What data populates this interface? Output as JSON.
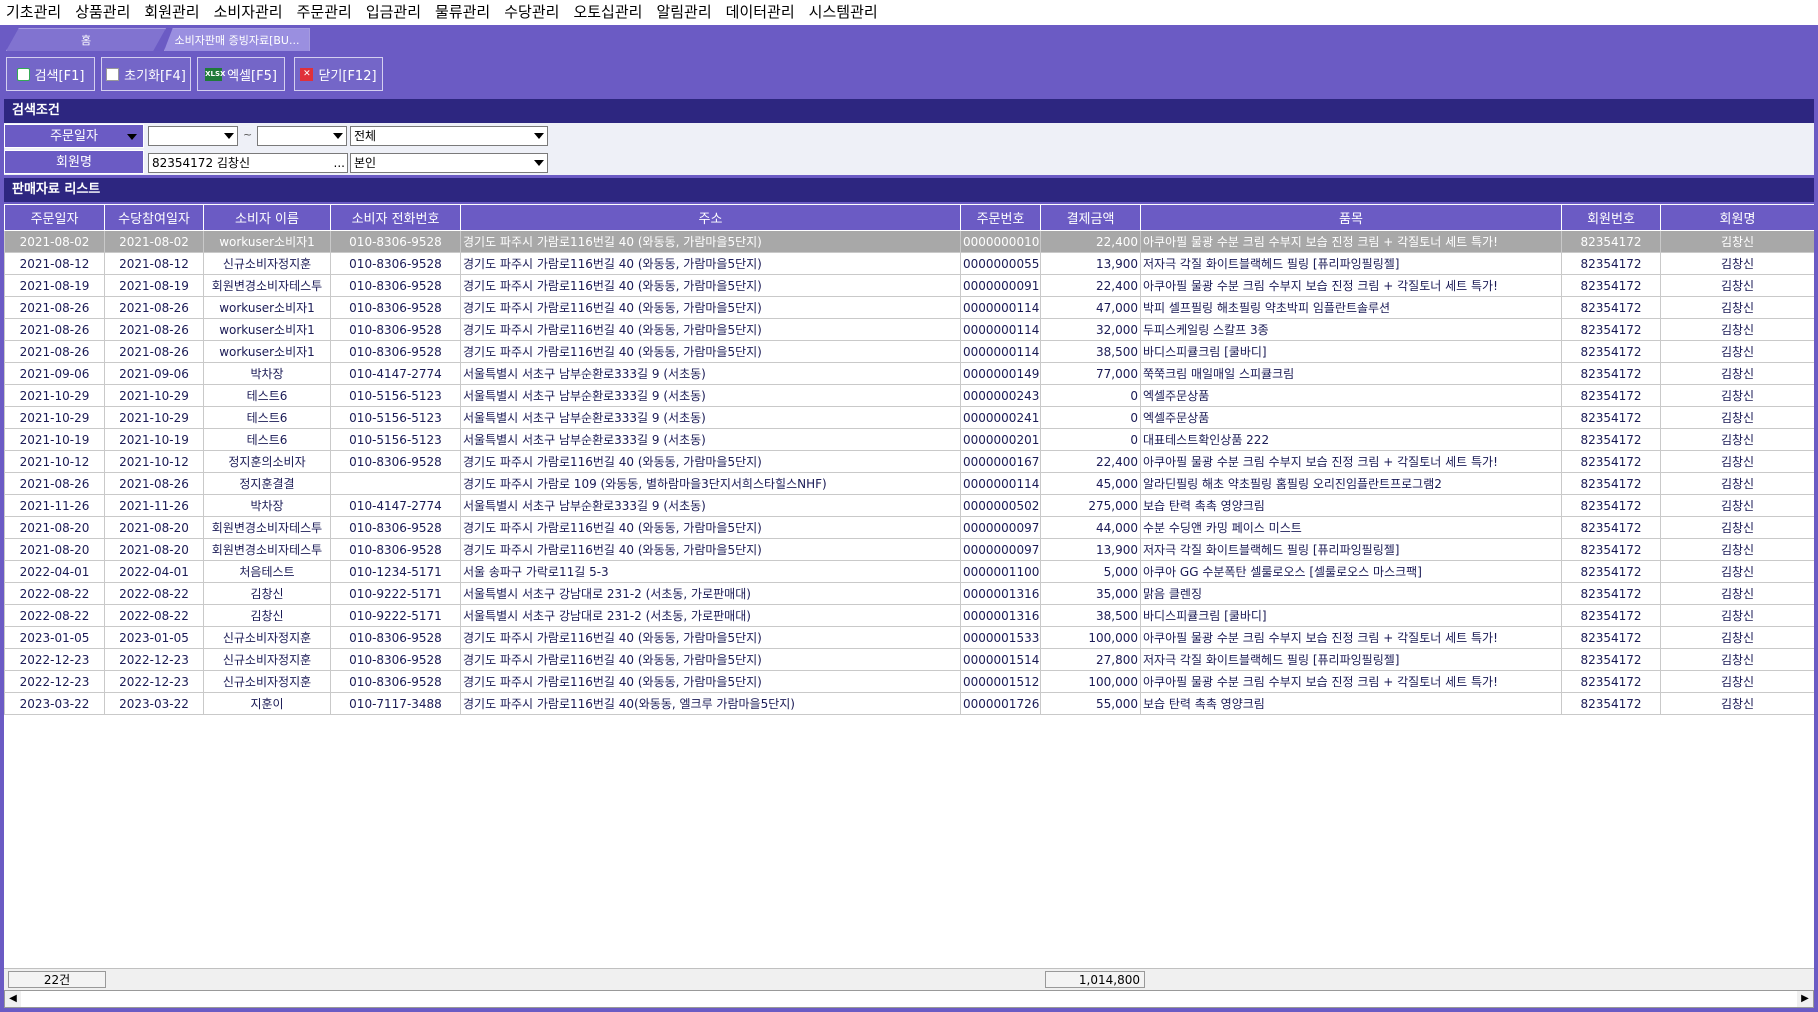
{
  "menu": [
    "기초관리",
    "상품관리",
    "회원관리",
    "소비자관리",
    "주문관리",
    "입금관리",
    "물류관리",
    "수당관리",
    "오토십관리",
    "알림관리",
    "데이터관리",
    "시스템관리"
  ],
  "tabs": {
    "home": "홈",
    "active": "소비자판매 증빙자료[BU..."
  },
  "toolbar": {
    "search": "검색[F1]",
    "reset": "초기화[F4]",
    "excel": "엑셀[F5]",
    "close": "닫기[F12]",
    "excel_icon_text": "XLSX"
  },
  "search_section": {
    "title": "검색조건",
    "order_date_label": "주문일자",
    "date_from": "",
    "tilde": "~",
    "date_to": "",
    "scope_value": "전체",
    "member_label": "회원명",
    "member_value": "82354172 김창신",
    "member_ellipsis": "...",
    "relation_value": "본인"
  },
  "list_section": {
    "title": "판매자료 리스트"
  },
  "columns": [
    "주문일자",
    "수당참여일자",
    "소비자 이름",
    "소비자 전화번호",
    "주소",
    "주문번호",
    "결제금액",
    "품목",
    "회원번호",
    "회원명"
  ],
  "rows": [
    [
      "2021-08-02",
      "2021-08-02",
      "workuser소비자1",
      "010-8306-9528",
      "경기도 파주시 가람로116번길 40 (와동동, 가람마을5단지)",
      "0000000010",
      "22,400",
      "아쿠아필 물광 수분 크림 수부지 보습 진정 크림 + 각질토너 세트 특가!",
      "82354172",
      "김창신"
    ],
    [
      "2021-08-12",
      "2021-08-12",
      "신규소비자정지훈",
      "010-8306-9528",
      "경기도 파주시 가람로116번길 40 (와동동, 가람마을5단지)",
      "0000000055",
      "13,900",
      "저자극 각질 화이트블랙헤드 필링 [퓨리파잉필링젤]",
      "82354172",
      "김창신"
    ],
    [
      "2021-08-19",
      "2021-08-19",
      "회원변경소비자테스투",
      "010-8306-9528",
      "경기도 파주시 가람로116번길 40 (와동동, 가람마을5단지)",
      "0000000091",
      "22,400",
      "아쿠아필 물광 수분 크림 수부지 보습 진정 크림 + 각질토너 세트 특가!",
      "82354172",
      "김창신"
    ],
    [
      "2021-08-26",
      "2021-08-26",
      "workuser소비자1",
      "010-8306-9528",
      "경기도 파주시 가람로116번길 40 (와동동, 가람마을5단지)",
      "0000000114",
      "47,000",
      "박피 셀프필링 해초필링 약초박피 임플란트솔루션",
      "82354172",
      "김창신"
    ],
    [
      "2021-08-26",
      "2021-08-26",
      "workuser소비자1",
      "010-8306-9528",
      "경기도 파주시 가람로116번길 40 (와동동, 가람마을5단지)",
      "0000000114",
      "32,000",
      "두피스케일링 스칼프 3종",
      "82354172",
      "김창신"
    ],
    [
      "2021-08-26",
      "2021-08-26",
      "workuser소비자1",
      "010-8306-9528",
      "경기도 파주시 가람로116번길 40 (와동동, 가람마을5단지)",
      "0000000114",
      "38,500",
      "바디스피큘크림 [쿨바디]",
      "82354172",
      "김창신"
    ],
    [
      "2021-09-06",
      "2021-09-06",
      "박차장",
      "010-4147-2774",
      "서울특별시 서초구 남부순환로333길 9 (서초동)",
      "0000000149",
      "77,000",
      "쭉쭉크림 매일매일 스피큘크림",
      "82354172",
      "김창신"
    ],
    [
      "2021-10-29",
      "2021-10-29",
      "테스트6",
      "010-5156-5123",
      "서울특별시 서초구 남부순환로333길 9 (서초동)",
      "0000000243",
      "0",
      "엑셀주문상품",
      "82354172",
      "김창신"
    ],
    [
      "2021-10-29",
      "2021-10-29",
      "테스트6",
      "010-5156-5123",
      "서울특별시 서초구 남부순환로333길 9 (서초동)",
      "0000000241",
      "0",
      "엑셀주문상품",
      "82354172",
      "김창신"
    ],
    [
      "2021-10-19",
      "2021-10-19",
      "테스트6",
      "010-5156-5123",
      "서울특별시 서초구 남부순환로333길 9 (서초동)",
      "0000000201",
      "0",
      "대표테스트확인상품 222",
      "82354172",
      "김창신"
    ],
    [
      "2021-10-12",
      "2021-10-12",
      "정지훈의소비자",
      "010-8306-9528",
      "경기도 파주시 가람로116번길 40 (와동동, 가람마을5단지)",
      "0000000167",
      "22,400",
      "아쿠아필 물광 수분 크림 수부지 보습 진정 크림 + 각질토너 세트 특가!",
      "82354172",
      "김창신"
    ],
    [
      "2021-08-26",
      "2021-08-26",
      "정지훈결결",
      "",
      "경기도 파주시 가람로 109 (와동동, 별하람마을3단지서희스타힐스NHF)",
      "0000000114",
      "45,000",
      "알라딘필링 해초 약초필링 홈필링 오리진임플란트프로그램2",
      "82354172",
      "김창신"
    ],
    [
      "2021-11-26",
      "2021-11-26",
      "박차장",
      "010-4147-2774",
      "서울특별시 서초구 남부순환로333길 9 (서초동)",
      "0000000502",
      "275,000",
      "보습 탄력 촉촉 영양크림",
      "82354172",
      "김창신"
    ],
    [
      "2021-08-20",
      "2021-08-20",
      "회원변경소비자테스투",
      "010-8306-9528",
      "경기도 파주시 가람로116번길 40 (와동동, 가람마을5단지)",
      "0000000097",
      "44,000",
      "수분 수딩앤 카밍 페이스 미스트",
      "82354172",
      "김창신"
    ],
    [
      "2021-08-20",
      "2021-08-20",
      "회원변경소비자테스투",
      "010-8306-9528",
      "경기도 파주시 가람로116번길 40 (와동동, 가람마을5단지)",
      "0000000097",
      "13,900",
      "저자극 각질 화이트블랙헤드 필링 [퓨리파잉필링젤]",
      "82354172",
      "김창신"
    ],
    [
      "2022-04-01",
      "2022-04-01",
      "처음테스트",
      "010-1234-5171",
      "서울 송파구 가락로11길 5-3",
      "0000001100",
      "5,000",
      "아쿠아 GG 수분폭탄 셀룰로오스 [셀룰로오스 마스크팩]",
      "82354172",
      "김창신"
    ],
    [
      "2022-08-22",
      "2022-08-22",
      "김창신",
      "010-9222-5171",
      "서울특별시 서초구 강남대로 231-2 (서초동, 가로판매대)",
      "0000001316",
      "35,000",
      "맑음 클렌징",
      "82354172",
      "김창신"
    ],
    [
      "2022-08-22",
      "2022-08-22",
      "김창신",
      "010-9222-5171",
      "서울특별시 서초구 강남대로 231-2 (서초동, 가로판매대)",
      "0000001316",
      "38,500",
      "바디스피큘크림 [쿨바디]",
      "82354172",
      "김창신"
    ],
    [
      "2023-01-05",
      "2023-01-05",
      "신규소비자정지훈",
      "010-8306-9528",
      "경기도 파주시 가람로116번길 40 (와동동, 가람마을5단지)",
      "0000001533",
      "100,000",
      "아쿠아필 물광 수분 크림 수부지 보습 진정 크림 + 각질토너 세트 특가!",
      "82354172",
      "김창신"
    ],
    [
      "2022-12-23",
      "2022-12-23",
      "신규소비자정지훈",
      "010-8306-9528",
      "경기도 파주시 가람로116번길 40 (와동동, 가람마을5단지)",
      "0000001514",
      "27,800",
      "저자극 각질 화이트블랙헤드 필링 [퓨리파잉필링젤]",
      "82354172",
      "김창신"
    ],
    [
      "2022-12-23",
      "2022-12-23",
      "신규소비자정지훈",
      "010-8306-9528",
      "경기도 파주시 가람로116번길 40 (와동동, 가람마을5단지)",
      "0000001512",
      "100,000",
      "아쿠아필 물광 수분 크림 수부지 보습 진정 크림 + 각질토너 세트 특가!",
      "82354172",
      "김창신"
    ],
    [
      "2023-03-22",
      "2023-03-22",
      "지훈이",
      "010-7117-3488",
      "경기도 파주시 가람로116번길 40(와동동, 엘크루 가람마을5단지)",
      "0000001726",
      "55,000",
      "보습 탄력 촉촉 영양크림",
      "82354172",
      "김창신"
    ]
  ],
  "selected_row": 0,
  "footer": {
    "count": "22건",
    "total": "1,014,800"
  },
  "colors": {
    "accent": "#6b5bc4",
    "section_header": "#2d2680",
    "selected_row": "#a8a8a8"
  }
}
